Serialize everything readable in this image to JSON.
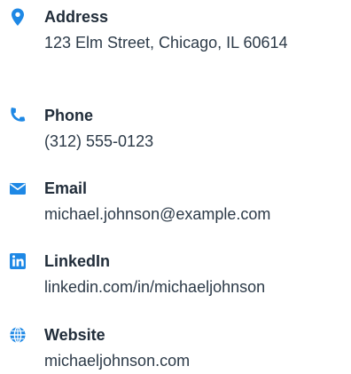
{
  "colors": {
    "accent": "#1e88e5",
    "label_text": "#212d3a",
    "value_text": "#2c3a48",
    "background": "#ffffff"
  },
  "contacts": [
    {
      "icon": "map-pin-icon",
      "label": "Address",
      "value": "123 Elm Street, Chicago, IL 60614"
    },
    {
      "icon": "phone-icon",
      "label": "Phone",
      "value": "(312) 555-0123"
    },
    {
      "icon": "envelope-icon",
      "label": "Email",
      "value": "michael.johnson@example.com"
    },
    {
      "icon": "linkedin-icon",
      "label": "LinkedIn",
      "value": "linkedin.com/in/michaeljohnson"
    },
    {
      "icon": "globe-icon",
      "label": "Website",
      "value": "michaeljohnson.com"
    }
  ]
}
